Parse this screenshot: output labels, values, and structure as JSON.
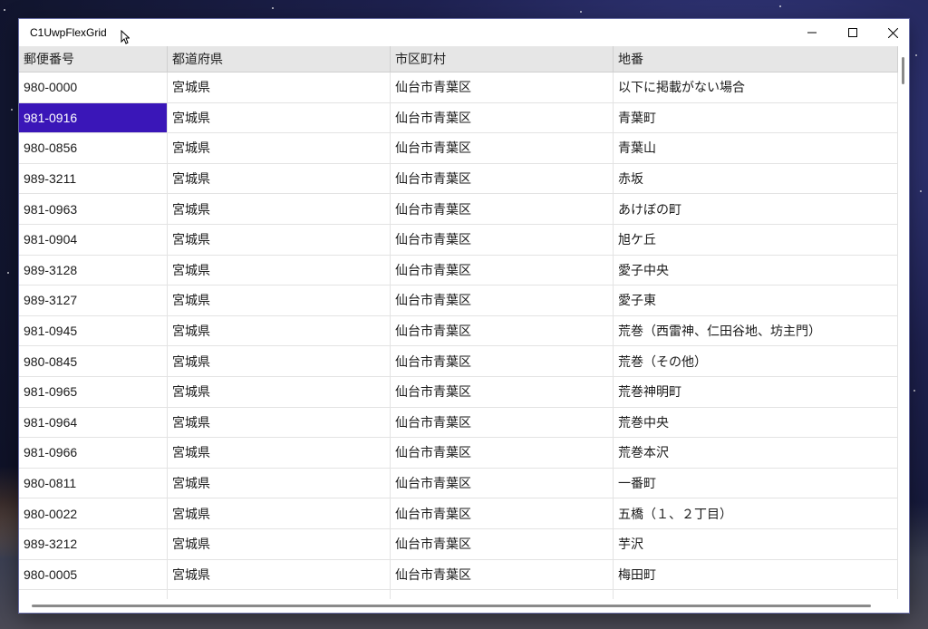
{
  "window": {
    "title": "C1UwpFlexGrid",
    "minimize_icon": "minimize-icon",
    "maximize_icon": "maximize-icon",
    "close_icon": "close-icon"
  },
  "grid": {
    "columns": [
      "郵便番号",
      "都道府県",
      "市区町村",
      "地番"
    ],
    "selected": {
      "row": 1,
      "col": 0
    },
    "rows": [
      [
        "980-0000",
        "宮城県",
        "仙台市青葉区",
        "以下に掲載がない場合"
      ],
      [
        "981-0916",
        "宮城県",
        "仙台市青葉区",
        "青葉町"
      ],
      [
        "980-0856",
        "宮城県",
        "仙台市青葉区",
        "青葉山"
      ],
      [
        "989-3211",
        "宮城県",
        "仙台市青葉区",
        "赤坂"
      ],
      [
        "981-0963",
        "宮城県",
        "仙台市青葉区",
        "あけぼの町"
      ],
      [
        "981-0904",
        "宮城県",
        "仙台市青葉区",
        "旭ケ丘"
      ],
      [
        "989-3128",
        "宮城県",
        "仙台市青葉区",
        "愛子中央"
      ],
      [
        "989-3127",
        "宮城県",
        "仙台市青葉区",
        "愛子東"
      ],
      [
        "981-0945",
        "宮城県",
        "仙台市青葉区",
        "荒巻（西雷神、仁田谷地、坊主門）"
      ],
      [
        "980-0845",
        "宮城県",
        "仙台市青葉区",
        "荒巻（その他）"
      ],
      [
        "981-0965",
        "宮城県",
        "仙台市青葉区",
        "荒巻神明町"
      ],
      [
        "981-0964",
        "宮城県",
        "仙台市青葉区",
        "荒巻中央"
      ],
      [
        "981-0966",
        "宮城県",
        "仙台市青葉区",
        "荒巻本沢"
      ],
      [
        "980-0811",
        "宮城県",
        "仙台市青葉区",
        "一番町"
      ],
      [
        "980-0022",
        "宮城県",
        "仙台市青葉区",
        "五橋（１、２丁目）"
      ],
      [
        "989-3212",
        "宮城県",
        "仙台市青葉区",
        "芋沢"
      ],
      [
        "980-0005",
        "宮城県",
        "仙台市青葉区",
        "梅田町"
      ],
      [
        "",
        "",
        "",
        ""
      ]
    ]
  },
  "colors": {
    "selection": "#3a16b8",
    "header_bg": "#e6e6e6"
  }
}
